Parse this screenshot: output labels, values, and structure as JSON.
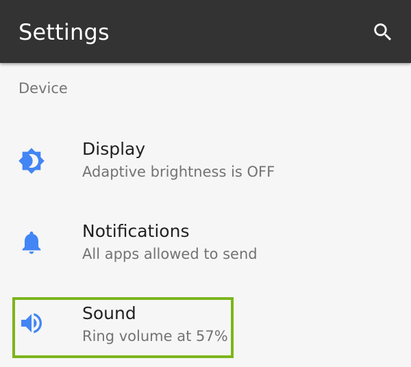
{
  "appbar": {
    "title": "Settings",
    "search_icon": "search-icon"
  },
  "section": {
    "header": "Device"
  },
  "items": [
    {
      "title": "Display",
      "summary": "Adaptive brightness is OFF",
      "icon": "brightness-icon"
    },
    {
      "title": "Notifications",
      "summary": "All apps allowed to send",
      "icon": "bell-icon"
    },
    {
      "title": "Sound",
      "summary": "Ring volume at 57%",
      "icon": "volume-icon"
    }
  ],
  "colors": {
    "appbar_bg": "#333333",
    "background": "#f6f6f6",
    "icon_accent": "#4285f4",
    "highlight": "#7cb51b"
  }
}
